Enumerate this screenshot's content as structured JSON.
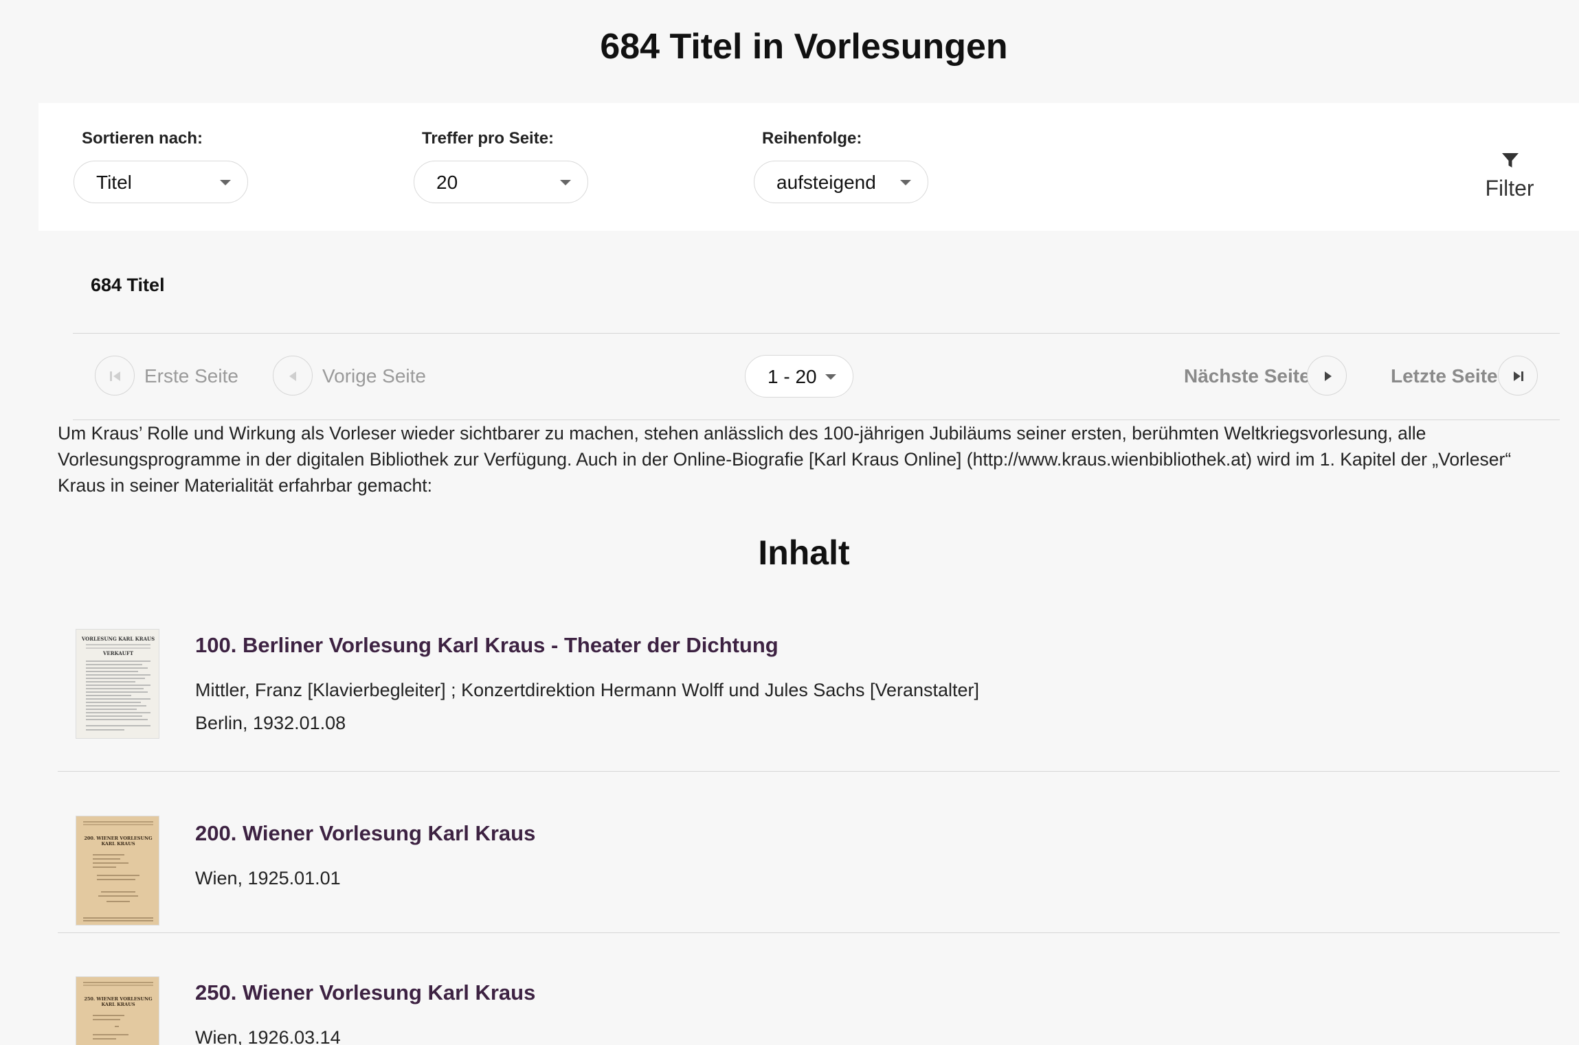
{
  "page": {
    "title": "684 Titel in Vorlesungen"
  },
  "toolbar": {
    "sort": {
      "label": "Sortieren nach:",
      "value": "Titel"
    },
    "per_page": {
      "label": "Treffer pro Seite:",
      "value": "20"
    },
    "order": {
      "label": "Reihenfolge:",
      "value": "aufsteigend"
    },
    "filter": {
      "label": "Filter",
      "icon": "filter-icon"
    }
  },
  "results": {
    "count_label": "684 Titel"
  },
  "pagination": {
    "first": {
      "label": "Erste Seite",
      "icon": "first-page-icon",
      "enabled": false
    },
    "prev": {
      "label": "Vorige Seite",
      "icon": "previous-page-icon",
      "enabled": false
    },
    "range": "1 - 20",
    "next": {
      "label": "Nächste Seite",
      "icon": "next-page-icon",
      "enabled": true
    },
    "last": {
      "label": "Letzte Seite",
      "icon": "last-page-icon",
      "enabled": true
    }
  },
  "intro": "Um Kraus’ Rolle und Wirkung als Vorleser wieder sichtbarer zu machen, stehen anlässlich des 100-jährigen Jubiläums seiner ersten, berühmten Weltkriegsvorlesung, alle Vorlesungsprogramme in der digitalen Bibliothek zur Verfügung. Auch in der Online-Biografie [Karl Kraus Online] (http://www.kraus.wienbibliothek.at) wird im 1. Kapitel der „Vorleser“ Kraus in seiner Materialität erfahrbar gemacht:",
  "section": {
    "title": "Inhalt"
  },
  "entries": [
    {
      "title": "100. Berliner Vorlesung Karl Kraus - Theater der Dichtung",
      "contributors": "Mittler, Franz [Klavierbegleiter] ; Konzertdirektion Hermann Wolff und Jules Sachs [Veranstalter]",
      "place_date": "Berlin, 1932.01.08",
      "thumb_heading": "VORLESUNG KARL KRAUS",
      "thumb_sub": "VERKAUFT"
    },
    {
      "title": "200. Wiener Vorlesung Karl Kraus",
      "place_date": "Wien, 1925.01.01",
      "thumb_heading": "200. WIENER VORLESUNG",
      "thumb_sub": "KARL KRAUS"
    },
    {
      "title": "250. Wiener Vorlesung Karl Kraus",
      "place_date": "Wien, 1926.03.14",
      "thumb_heading": "250. WIENER VORLESUNG",
      "thumb_sub": "KARL KRAUS"
    }
  ],
  "colors": {
    "accent": "#3d2242",
    "background": "#f7f7f7",
    "panel": "#ffffff"
  }
}
